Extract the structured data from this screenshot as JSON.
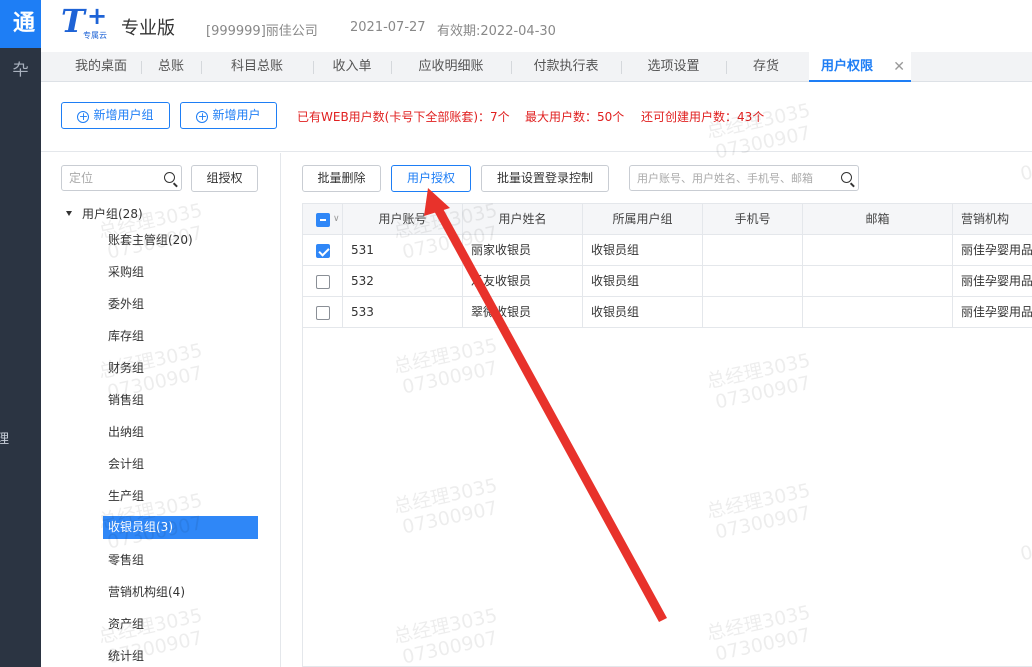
{
  "rail": {
    "logo_text": "通",
    "icon_glyph": "卆",
    "text": "理"
  },
  "header": {
    "brand_t": "T",
    "brand_plus": "+",
    "brand_sub": "专属云",
    "edition": "专业版",
    "company": "[999999]丽佳公司",
    "date": "2021-07-27",
    "expiry": "有效期:2022-04-30"
  },
  "tabs": [
    {
      "label": "我的桌面"
    },
    {
      "label": "总账"
    },
    {
      "label": "科目总账"
    },
    {
      "label": "收入单"
    },
    {
      "label": "应收明细账"
    },
    {
      "label": "付款执行表"
    },
    {
      "label": "选项设置"
    },
    {
      "label": "存货"
    },
    {
      "label": "用户权限",
      "active": true,
      "close": "✕"
    }
  ],
  "toolbar": {
    "new_group_label": "新增用户组",
    "new_user_label": "新增用户",
    "stat_web": "已有WEB用户数(卡号下全部账套)：7个",
    "stat_max": "最大用户数：50个",
    "stat_remaining": "还可创建用户数：43个"
  },
  "tree": {
    "search_placeholder": "定位",
    "group_auth_label": "组授权",
    "root_label": "用户组(28)",
    "items": [
      "账套主管组(20)",
      "采购组",
      "委外组",
      "库存组",
      "财务组",
      "销售组",
      "出纳组",
      "会计组",
      "生产组",
      "收银员组(3)",
      "零售组",
      "营销机构组(4)",
      "资产组",
      "统计组"
    ],
    "selected_index": 9
  },
  "grid": {
    "batch_delete_label": "批量删除",
    "user_auth_label": "用户授权",
    "batch_login_label": "批量设置登录控制",
    "search_placeholder": "用户账号、用户姓名、手机号、邮箱",
    "columns": [
      "用户账号",
      "用户姓名",
      "所属用户组",
      "手机号",
      "邮箱",
      "营销机构"
    ],
    "rows": [
      {
        "checked": true,
        "account": "531",
        "name": "丽家收银员",
        "group": "收银员组",
        "phone": "",
        "email": "",
        "org": "丽佳孕婴用品"
      },
      {
        "checked": false,
        "account": "532",
        "name": "乐友收银员",
        "group": "收银员组",
        "phone": "",
        "email": "",
        "org": "丽佳孕婴用品"
      },
      {
        "checked": false,
        "account": "533",
        "name": "翠微收银员",
        "group": "收银员组",
        "phone": "",
        "email": "",
        "org": "丽佳孕婴用品"
      }
    ]
  },
  "watermark": {
    "line1": "总经理3035",
    "line2": "07300907"
  },
  "colors": {
    "accent": "#1e7ef5",
    "rail": "#2b3442",
    "warning_text": "#e02020",
    "arrow": "#e8322b"
  }
}
